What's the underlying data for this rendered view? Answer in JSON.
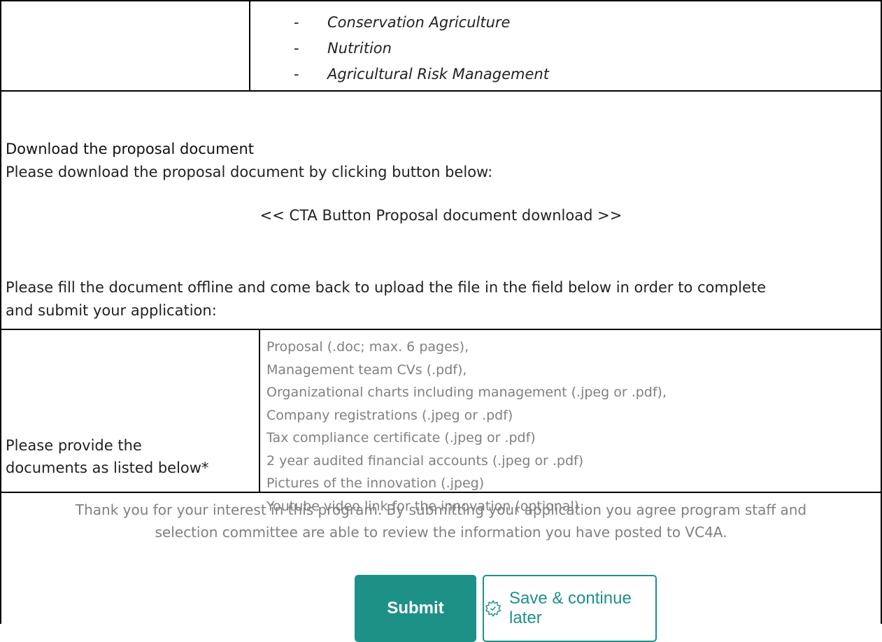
{
  "top_list": {
    "items": [
      "Conservation Agriculture",
      "Nutrition",
      "Agricultural Risk Management"
    ],
    "dash": "-"
  },
  "download_section": {
    "heading": "Download the proposal document",
    "instruction": "Please download the proposal document by clicking button below:",
    "cta_placeholder": "<< CTA Button Proposal document download >>",
    "fill_line1": "Please fill the document offline and come back to upload the file in the field below in order to complete",
    "fill_line2": "and submit your application:"
  },
  "documents": {
    "label_line1": "Please provide the",
    "label_line2": "documents as listed below*",
    "items": [
      "Proposal (.doc; max. 6 pages),",
      "Management team CVs (.pdf),",
      "Organizational charts including management (.jpeg or .pdf),",
      "Company registrations (.jpeg or .pdf)",
      "Tax compliance certificate (.jpeg or .pdf)",
      "2 year audited financial accounts (.jpeg or .pdf)",
      "Pictures of the innovation (.jpeg)",
      "Youtube video link for the innovation (optional)"
    ]
  },
  "footer": {
    "thanks_line1": "Thank you for your interest in this program. By submitting your application you agree program staff and",
    "thanks_line2": "selection committee are able to review the information you have posted to VC4A.",
    "submit_label": "Submit",
    "save_label": "Save & continue later",
    "save_icon": "settings-gear-icon",
    "accent_color": "#1e9187"
  }
}
